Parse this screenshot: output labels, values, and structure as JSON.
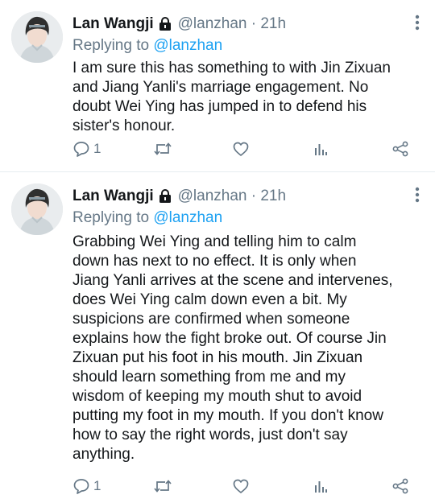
{
  "tweets": [
    {
      "author": "Lan Wangji",
      "handle": "@lanzhan",
      "separator": "·",
      "time": "21h",
      "replying_prefix": "Replying to ",
      "replying_to": "@lanzhan",
      "text": "I am sure this has something to with Jin Zixuan\nand Jiang Yanli's marriage engagement. No\ndoubt Wei Ying has jumped in to defend his\nsister's honour.",
      "reply_count": "1"
    },
    {
      "author": "Lan Wangji",
      "handle": "@lanzhan",
      "separator": "·",
      "time": "21h",
      "replying_prefix": "Replying to ",
      "replying_to": "@lanzhan",
      "text": "Grabbing Wei Ying and telling him to calm\ndown has next to no effect. It is only when\nJiang Yanli arrives at the scene and intervenes,\ndoes Wei Ying calm down even a bit. My\nsuspicions are confirmed when someone\nexplains how the fight broke out. Of course Jin\nZixuan put his foot in his mouth. Jin Zixuan\nshould learn something from me and my\nwisdom of keeping my mouth shut to avoid\nputting my foot in my mouth. If you don't know\nhow to say the right words, just don't say\nanything.",
      "reply_count": "1"
    }
  ],
  "icons": {
    "avatar": "avatar",
    "lock": "lock-icon",
    "more": "more-vertical-icon",
    "reply": "reply-icon",
    "retweet": "retweet-icon",
    "like": "heart-icon",
    "stats": "analytics-icon",
    "share": "share-icon"
  },
  "colors": {
    "accent": "#1da1f2",
    "secondary_text": "#657786",
    "text": "#14171a"
  }
}
